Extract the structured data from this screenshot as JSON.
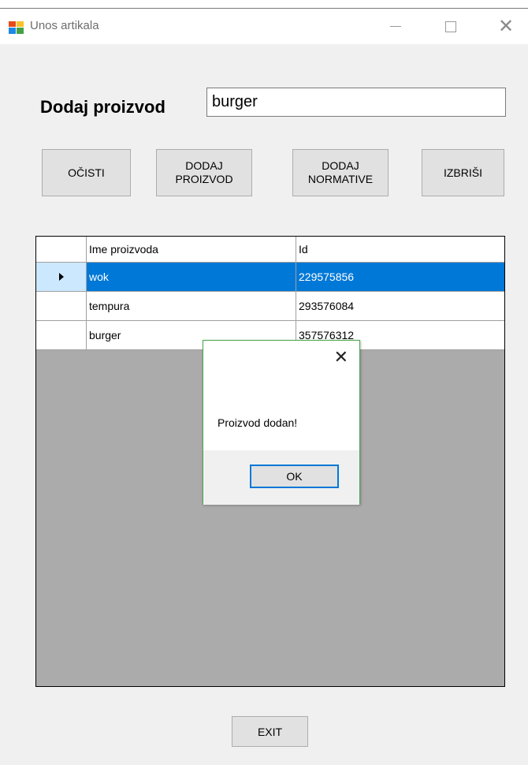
{
  "window": {
    "title": "Unos artikala",
    "icon": "winforms-app-icon"
  },
  "form": {
    "label": "Dodaj proizvod",
    "name_value": "burger"
  },
  "buttons": {
    "clear": "OČISTI",
    "add_product": "DODAJ\nPROIZVOD",
    "add_norms": "DODAJ\nNORMATIVE",
    "delete": "IZBRIŠI",
    "exit": "EXIT"
  },
  "grid": {
    "columns": [
      "Ime proizvoda",
      "Id"
    ],
    "rows": [
      {
        "name": "wok",
        "id": "229575856"
      },
      {
        "name": "tempura",
        "id": "293576084"
      },
      {
        "name": "burger",
        "id": "357576312"
      }
    ],
    "selected_row": 0,
    "selection_color": "#0078d7"
  },
  "dialog": {
    "message": "Proizvod dodan!",
    "ok_label": "OK"
  }
}
